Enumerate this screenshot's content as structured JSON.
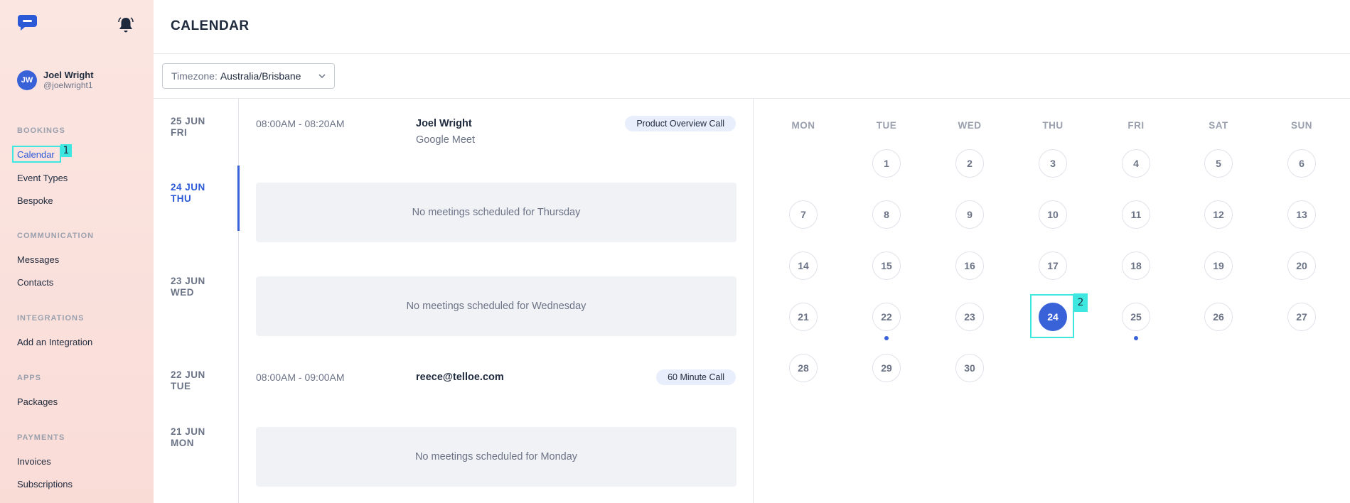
{
  "header": {
    "title": "CALENDAR"
  },
  "user": {
    "initials": "JW",
    "name": "Joel Wright",
    "handle": "@joelwright1"
  },
  "sidebar": {
    "sections": [
      {
        "title": "BOOKINGS",
        "items": [
          "Calendar",
          "Event Types",
          "Bespoke"
        ]
      },
      {
        "title": "COMMUNICATION",
        "items": [
          "Messages",
          "Contacts"
        ]
      },
      {
        "title": "INTEGRATIONS",
        "items": [
          "Add an Integration"
        ]
      },
      {
        "title": "APPS",
        "items": [
          "Packages"
        ]
      },
      {
        "title": "PAYMENTS",
        "items": [
          "Invoices",
          "Subscriptions"
        ]
      }
    ],
    "active_item": "Calendar"
  },
  "markers": [
    "1",
    "2"
  ],
  "timezone": {
    "label": "Timezone:",
    "value": "Australia/Brisbane"
  },
  "days": [
    {
      "date": "25 JUN",
      "weekday": "FRI",
      "event": {
        "time": "08:00AM - 08:20AM",
        "name": "Joel Wright",
        "location": "Google Meet",
        "type": "Product Overview Call"
      }
    },
    {
      "date": "24 JUN",
      "weekday": "THU",
      "current": true,
      "empty": "No meetings scheduled for Thursday"
    },
    {
      "date": "23 JUN",
      "weekday": "WED",
      "empty": "No meetings scheduled for Wednesday"
    },
    {
      "date": "22 JUN",
      "weekday": "TUE",
      "event": {
        "time": "08:00AM - 09:00AM",
        "name": "reece@telloe.com",
        "type": "60 Minute Call"
      }
    },
    {
      "date": "21 JUN",
      "weekday": "MON",
      "empty": "No meetings scheduled for Monday"
    }
  ],
  "calendar": {
    "weekdays": [
      "MON",
      "TUE",
      "WED",
      "THU",
      "FRI",
      "SAT",
      "SUN"
    ],
    "first_weekday_index": 1,
    "days_in_month": 30,
    "selected": 24,
    "days_with_events": [
      22,
      25
    ],
    "accent": "#3a62d8"
  }
}
